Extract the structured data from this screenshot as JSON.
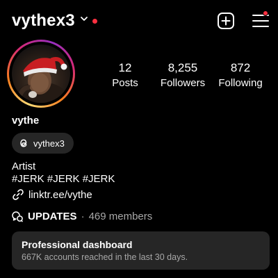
{
  "header": {
    "username": "vythex3",
    "notification_color": "#ff3040",
    "icons": [
      "chevron-down-icon",
      "new-post-icon",
      "menu-icon"
    ]
  },
  "profile": {
    "stats": [
      {
        "value": "12",
        "label": "Posts"
      },
      {
        "value": "8,255",
        "label": "Followers"
      },
      {
        "value": "872",
        "label": "Following"
      }
    ],
    "display_name": "vythe",
    "threads_handle": "vythex3",
    "bio": [
      "Artist",
      "#JERK #JERK #JERK"
    ],
    "link": "linktr.ee/vythe"
  },
  "channel": {
    "name": "UPDATES",
    "separator": "·",
    "members": "469 members"
  },
  "dashboard": {
    "title": "Professional dashboard",
    "subtitle": "667K accounts reached in the last 30 days."
  },
  "colors": {
    "background": "#000000",
    "card": "#262626",
    "secondary_text": "#a8a8a8"
  }
}
